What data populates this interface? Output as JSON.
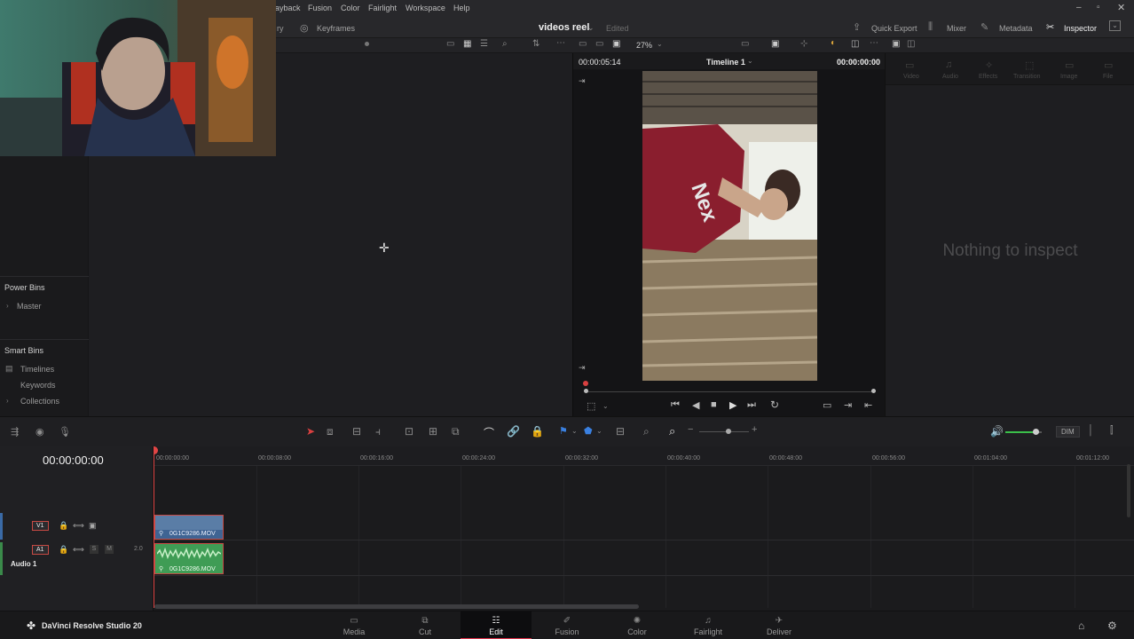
{
  "menubar": {
    "items": [
      "ayback",
      "Fusion",
      "Color",
      "Fairlight",
      "Workspace",
      "Help"
    ],
    "window_controls": [
      "minimize-icon",
      "restore-icon",
      "close-icon"
    ]
  },
  "toolbar": {
    "left_label": "ry",
    "keyframes_label": "Keyframes",
    "project_name": "videos reel",
    "edited_label": "Edited",
    "quick_export_label": "Quick Export",
    "mixer_label": "Mixer",
    "metadata_label": "Metadata",
    "inspector_label": "Inspector"
  },
  "viewer": {
    "timecode_left": "00:00:05:14",
    "timeline_name": "Timeline 1",
    "timecode_right": "00:00:00:00",
    "zoom": "27%"
  },
  "inspector": {
    "tabs": [
      "Video",
      "Audio",
      "Effects",
      "Transition",
      "Image",
      "File"
    ],
    "empty_message": "Nothing to inspect"
  },
  "bins": {
    "power_bins_title": "Power Bins",
    "power_bins": [
      "Master"
    ],
    "smart_bins_title": "Smart Bins",
    "smart_bins": [
      "Timelines",
      "Keywords",
      "Collections"
    ]
  },
  "timeline": {
    "current_timecode": "00:00:00:00",
    "ruler_ticks": [
      "00:00:00:00",
      "00:00:08:00",
      "00:00:16:00",
      "00:00:24:00",
      "00:00:32:00",
      "00:00:40:00",
      "00:00:48:00",
      "00:00:56:00",
      "00:01:04:00",
      "00:01:12:00"
    ],
    "video_track": {
      "id": "V1"
    },
    "audio_track": {
      "id": "A1",
      "name": "Audio 1",
      "channel": "2.0",
      "solo": "S",
      "mute": "M"
    },
    "video_clip_name": "0G1C9286.MOV",
    "audio_clip_name": "0G1C9286.MOV",
    "dim_label": "DIM"
  },
  "pagebar": {
    "app_name": "DaVinci Resolve Studio 20",
    "pages": [
      "Media",
      "Cut",
      "Edit",
      "Fusion",
      "Color",
      "Fairlight",
      "Deliver"
    ],
    "active_page": "Edit"
  }
}
